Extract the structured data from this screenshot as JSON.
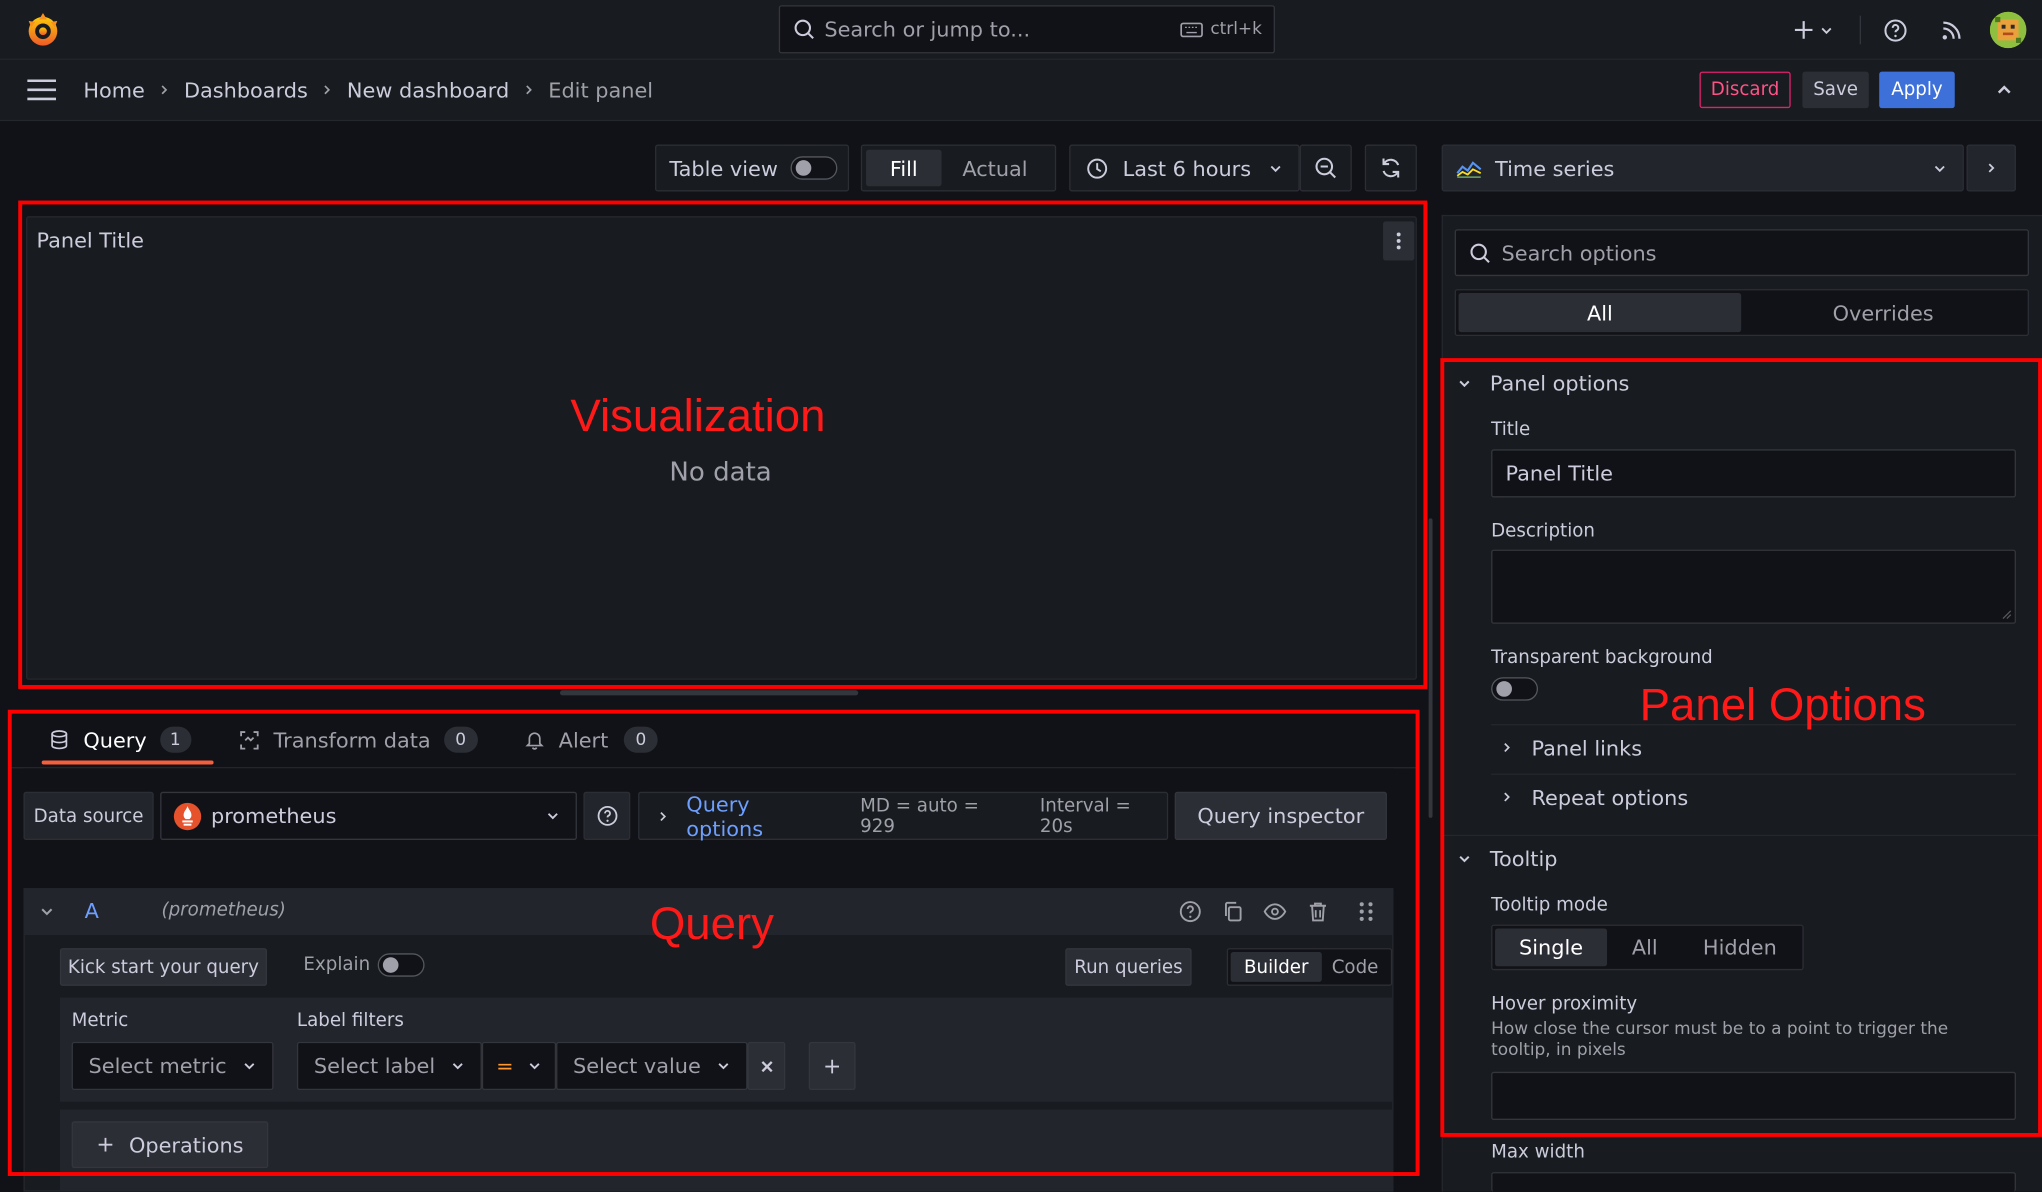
{
  "topbar": {
    "search_placeholder": "Search or jump to...",
    "search_shortcut": "ctrl+k"
  },
  "breadcrumb": {
    "items": [
      "Home",
      "Dashboards",
      "New dashboard",
      "Edit panel"
    ]
  },
  "actions": {
    "discard": "Discard",
    "save": "Save",
    "apply": "Apply"
  },
  "toolbar": {
    "table_view": "Table view",
    "fill": "Fill",
    "actual": "Actual",
    "time_range": "Last 6 hours"
  },
  "viz_picker": {
    "selected": "Time series"
  },
  "panel": {
    "title": "Panel Title",
    "no_data": "No data"
  },
  "annotations": {
    "visualization": "Visualization",
    "query": "Query",
    "panel_options": "Panel Options"
  },
  "tabs": [
    {
      "label": "Query",
      "count": "1"
    },
    {
      "label": "Transform data",
      "count": "0"
    },
    {
      "label": "Alert",
      "count": "0"
    }
  ],
  "datasource": {
    "label": "Data source",
    "value": "prometheus",
    "query_options": "Query options",
    "md": "MD = auto = 929",
    "interval": "Interval = 20s",
    "inspector": "Query inspector"
  },
  "query_row": {
    "ref": "A",
    "ds": "(prometheus)",
    "kick_start": "Kick start your query",
    "explain": "Explain",
    "run": "Run queries",
    "builder": "Builder",
    "code": "Code",
    "metric_label": "Metric",
    "metric_placeholder": "Select metric",
    "label_filters": "Label filters",
    "label_placeholder": "Select label",
    "operator": "=",
    "value_placeholder": "Select value",
    "operations": "Operations"
  },
  "options": {
    "search_placeholder": "Search options",
    "tab_all": "All",
    "tab_overrides": "Overrides",
    "panel_options": "Panel options",
    "title_label": "Title",
    "title_value": "Panel Title",
    "description_label": "Description",
    "transparent_label": "Transparent background",
    "panel_links": "Panel links",
    "repeat_options": "Repeat options",
    "tooltip": "Tooltip",
    "tooltip_mode": "Tooltip mode",
    "modes": [
      "Single",
      "All",
      "Hidden"
    ],
    "hover_proximity": "Hover proximity",
    "hover_desc": "How close the cursor must be to a point to trigger the tooltip, in pixels",
    "max_width": "Max width"
  },
  "colors": {
    "accent_blue": "#3d71d9",
    "link_blue": "#6e9fff",
    "discard_red": "#e0226e",
    "tab_orange": "#f55f3e",
    "annotation_red": "#ff0000"
  }
}
